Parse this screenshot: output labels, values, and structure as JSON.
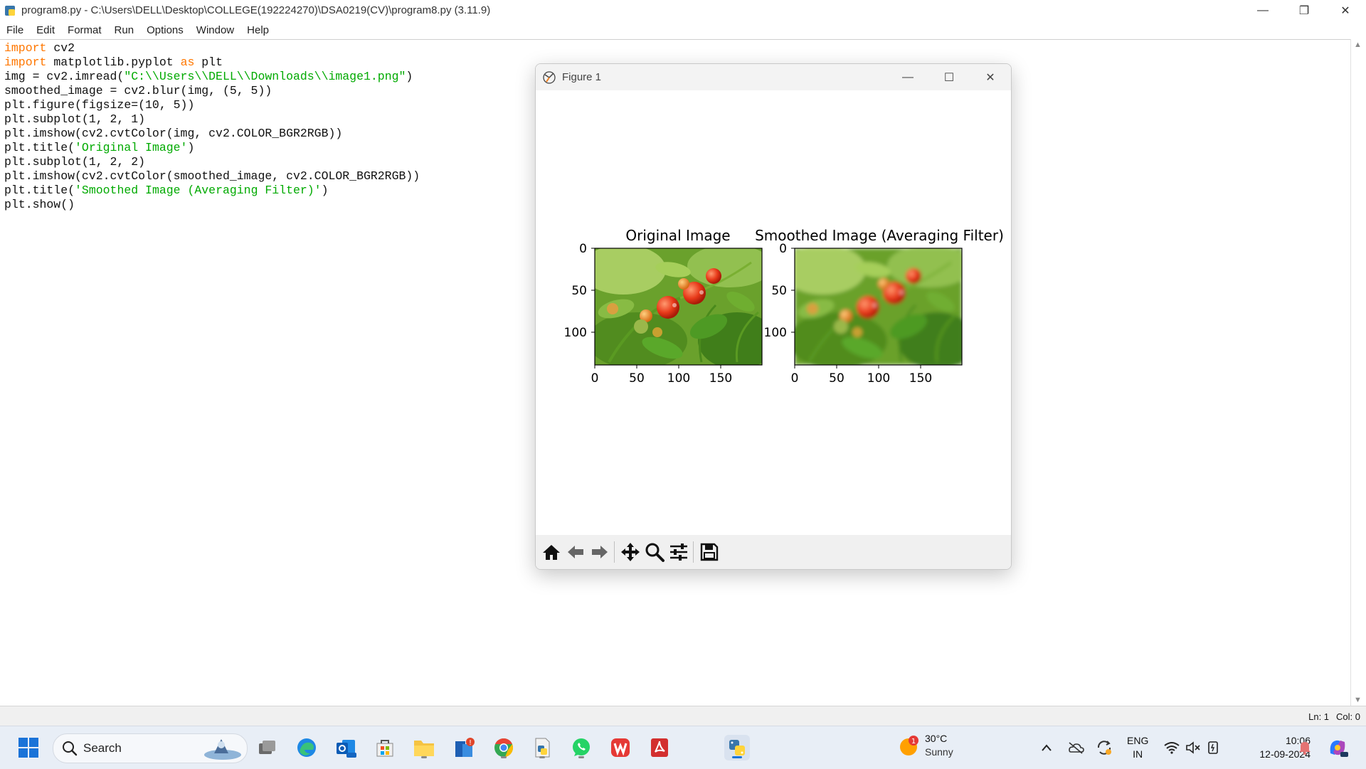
{
  "window": {
    "title": "program8.py - C:\\Users\\DELL\\Desktop\\COLLEGE(192224270)\\DSA0219(CV)\\program8.py (3.11.9)",
    "minimize": "—",
    "maximize": "❐",
    "close": "✕"
  },
  "menu": [
    "File",
    "Edit",
    "Format",
    "Run",
    "Options",
    "Window",
    "Help"
  ],
  "code": [
    [
      {
        "t": "import",
        "c": "kw"
      },
      {
        "t": " cv2",
        "c": ""
      }
    ],
    [
      {
        "t": "import",
        "c": "kw"
      },
      {
        "t": " matplotlib.pyplot ",
        "c": ""
      },
      {
        "t": "as",
        "c": "kw"
      },
      {
        "t": " plt",
        "c": ""
      }
    ],
    [
      {
        "t": "img = cv2.imread(",
        "c": ""
      },
      {
        "t": "\"C:\\\\Users\\\\DELL\\\\Downloads\\\\image1.png\"",
        "c": "str"
      },
      {
        "t": ")",
        "c": ""
      }
    ],
    [
      {
        "t": "smoothed_image = cv2.blur(img, (5, 5))",
        "c": ""
      }
    ],
    [
      {
        "t": "plt.figure(figsize=(10, 5))",
        "c": ""
      }
    ],
    [
      {
        "t": "plt.subplot(1, 2, 1)",
        "c": ""
      }
    ],
    [
      {
        "t": "plt.imshow(cv2.cvtColor(img, cv2.COLOR_BGR2RGB))",
        "c": ""
      }
    ],
    [
      {
        "t": "plt.title(",
        "c": ""
      },
      {
        "t": "'Original Image'",
        "c": "str"
      },
      {
        "t": ")",
        "c": ""
      }
    ],
    [
      {
        "t": "plt.subplot(1, 2, 2)",
        "c": ""
      }
    ],
    [
      {
        "t": "plt.imshow(cv2.cvtColor(smoothed_image, cv2.COLOR_BGR2RGB))",
        "c": ""
      }
    ],
    [
      {
        "t": "plt.title(",
        "c": ""
      },
      {
        "t": "'Smoothed Image (Averaging Filter)'",
        "c": "str"
      },
      {
        "t": ")",
        "c": ""
      }
    ],
    [
      {
        "t": "plt.show()",
        "c": ""
      }
    ]
  ],
  "status": {
    "line": "Ln: 1",
    "col": "Col: 0"
  },
  "figure": {
    "title": "Figure 1",
    "subplots": [
      {
        "title": "Original Image",
        "yticks": [
          "0",
          "50",
          "100"
        ],
        "xticks": [
          "0",
          "50",
          "100",
          "150"
        ]
      },
      {
        "title": "Smoothed Image (Averaging Filter)",
        "yticks": [
          "0",
          "50",
          "100"
        ],
        "xticks": [
          "0",
          "50",
          "100",
          "150"
        ]
      }
    ],
    "toolbar": [
      "home-icon",
      "back-icon",
      "forward-icon",
      "pan-icon",
      "zoom-icon",
      "configure-icon",
      "save-icon"
    ]
  },
  "taskbar": {
    "search_label": "Search",
    "weather": {
      "temp": "30°C",
      "cond": "Sunny",
      "badge": "1"
    },
    "lang": {
      "line1": "ENG",
      "line2": "IN"
    },
    "time": "10:06",
    "date": "12-09-2024"
  }
}
